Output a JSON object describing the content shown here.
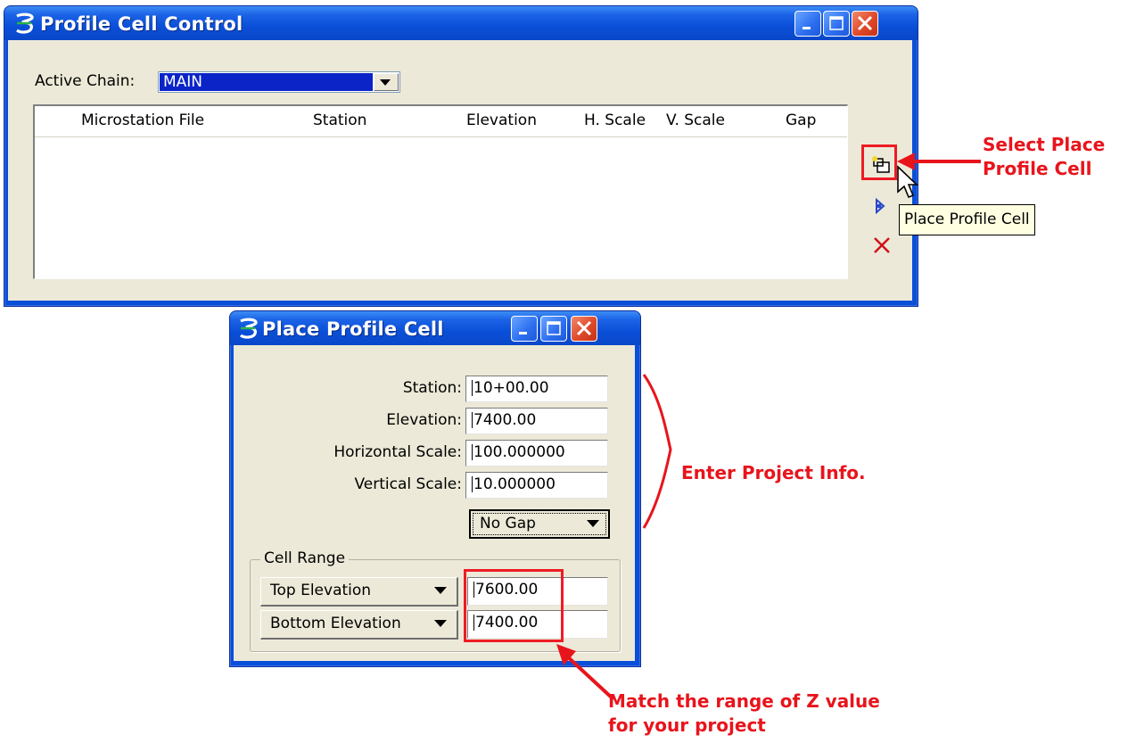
{
  "profile_cell_control": {
    "title": "Profile Cell Control",
    "active_chain_label": "Active Chain:",
    "active_chain_value": "MAIN",
    "columns": [
      "Microstation File",
      "Station",
      "Elevation",
      "H. Scale",
      "V. Scale",
      "Gap"
    ],
    "tooltip": "Place Profile Cell"
  },
  "place_profile_cell": {
    "title": "Place Profile Cell",
    "station_label": "Station:",
    "station_value": "10+00.00",
    "elevation_label": "Elevation:",
    "elevation_value": "7400.00",
    "hscale_label": "Horizontal Scale:",
    "hscale_value": "100.000000",
    "vscale_label": "Vertical Scale:",
    "vscale_value": "10.000000",
    "gap_option": "No Gap",
    "cell_range_label": "Cell Range",
    "top_option": "Top Elevation",
    "top_value": "7600.00",
    "bottom_option": "Bottom Elevation",
    "bottom_value": "7400.00"
  },
  "annotations": {
    "select_line1": "Select Place",
    "select_line2": "Profile Cell",
    "enter_info": "Enter Project Info.",
    "match_line1": "Match the range of Z value",
    "match_line2": "for your project"
  },
  "colors": {
    "title_blue": "#0a4fd8",
    "dialog_bg": "#ece9d8",
    "selection_blue": "#0a24c8",
    "annotation_red": "#e8141c"
  }
}
